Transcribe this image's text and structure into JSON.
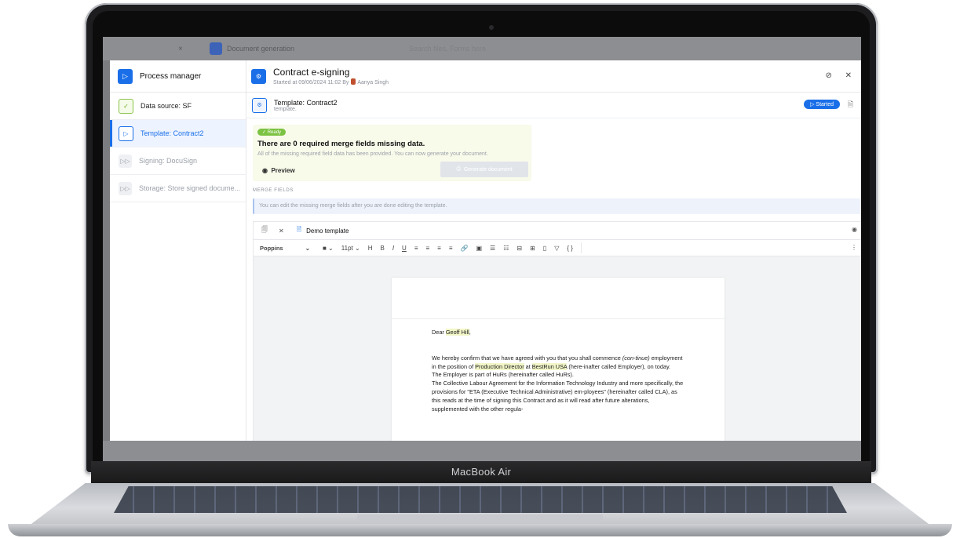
{
  "device": {
    "label": "MacBook Air"
  },
  "background_app": {
    "close_glyph": "×",
    "title": "Document generation",
    "search_placeholder": "Search files, Forms here"
  },
  "sidebar": {
    "header": {
      "icon": "play-icon",
      "label": "Process manager"
    },
    "steps": [
      {
        "label": "Data source: SF",
        "status": "done",
        "icon": "check-icon"
      },
      {
        "label": "Template: Contract2",
        "status": "active",
        "icon": "play-icon"
      },
      {
        "label": "Signing: DocuSign",
        "status": "pending",
        "icon": "fast-forward-icon"
      },
      {
        "label": "Storage: Store signed docume...",
        "status": "pending",
        "icon": "fast-forward-icon"
      }
    ]
  },
  "header": {
    "title": "Contract e-signing",
    "subtitle_prefix": "Started at 09/06/2024 11:02 By",
    "user": "Aanya Singh"
  },
  "template": {
    "title": "Template: Contract2",
    "subtitle": "template.",
    "status_badge": "▷ Started"
  },
  "ready_card": {
    "badge": "✓ Ready",
    "title": "There are 0 required merge fields missing data.",
    "description": "All of the missing required field data has been provided. You can now generate your document.",
    "preview_label": "Preview",
    "generate_label": "Generate document"
  },
  "merge_fields": {
    "label": "MERGE FIELDS",
    "info": "You can edit the missing merge fields after you are done editing the template."
  },
  "editor": {
    "tab_label": "Demo template",
    "font": "Poppins",
    "font_size": "11pt",
    "toolbar_glyphs": [
      "H",
      "B",
      "I",
      "U",
      "≡",
      "≡",
      "≡",
      "≡",
      "🔗",
      "▣",
      "☰",
      "☷",
      "⊟",
      "⊞",
      "▯",
      "▽",
      "{ }"
    ]
  },
  "document": {
    "greeting_prefix": "Dear",
    "greeting_name": "Geoff Hill",
    "greeting_suffix": ",",
    "p1_a": "We hereby confirm that we have agreed with you that you shall commence ",
    "p1_italic": "(con-tinue)",
    "p1_b": " employment in the position of ",
    "position": "Production Director",
    "p1_c": " at ",
    "company": "BestRun USA",
    "p1_d": " (here-inafter called Employer), on today.",
    "line2": "The Employer is part of HuRs (hereinafter called HuRs).",
    "line3": "The Collective Labour Agreement for the Information Technology Industry and more specifically, the provisions for \"ETA (Executive Technical Administrative) em-ployees\" (hereinafter called CLA), as this reads at the time of signing this Contract and as it will read after future alterations, supplemented with the other regula-"
  }
}
